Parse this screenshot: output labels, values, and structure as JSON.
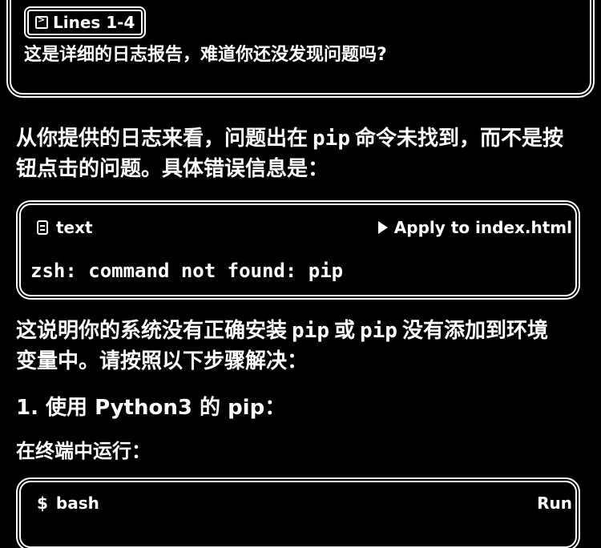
{
  "user_card": {
    "chip_label": "Lines 1-4",
    "message": "这是详细的日志报告，难道你还没发现问题吗?"
  },
  "answer": {
    "p1_a": "从你提供的日志来看，问题出在",
    "p1_code": "pip",
    "p1_b": "命令未找到，而不是按",
    "p1_line2": "钮点击的问题。具体错误信息是：",
    "code1": {
      "lang": "text",
      "apply_label": "Apply to index.html",
      "content": "zsh: command not found: pip"
    },
    "p2_a": "这说明你的系统没有正确安装",
    "p2_code1": "pip",
    "p2_b": "或",
    "p2_code2": "pip",
    "p2_c": "没有添加到环境",
    "p2_line2": "变量中。请按照以下步骤解决：",
    "heading1": "1. 使用 Python3 的 pip：",
    "p3": "在终端中运行：",
    "code2": {
      "lang": "bash",
      "run_label": "Run"
    }
  }
}
